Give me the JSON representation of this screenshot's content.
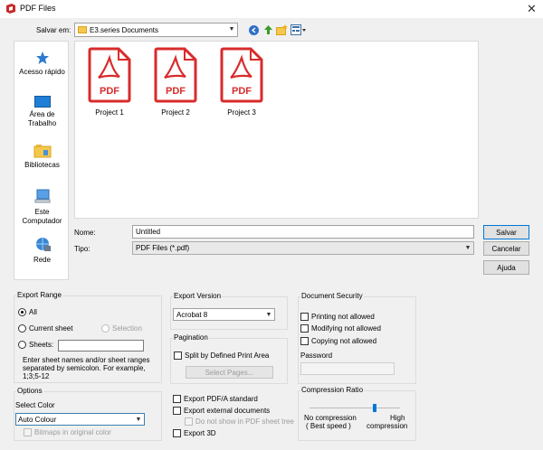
{
  "window": {
    "title": "PDF Files"
  },
  "toolbar": {
    "save_in_label": "Salvar em:",
    "save_in_value": "E3.series Documents"
  },
  "sidebar": {
    "items": [
      {
        "label": "Acesso rápido"
      },
      {
        "label": "Área de Trabalho"
      },
      {
        "label": "Bibliotecas"
      },
      {
        "label": "Este Computador"
      },
      {
        "label": "Rede"
      }
    ]
  },
  "files": [
    {
      "name": "Project 1",
      "badge": "PDF"
    },
    {
      "name": "Project 2",
      "badge": "PDF"
    },
    {
      "name": "Project 3",
      "badge": "PDF"
    }
  ],
  "form": {
    "name_label": "Nome:",
    "name_value": "Untitled",
    "type_label": "Tipo:",
    "type_value": "PDF Files (*.pdf)"
  },
  "buttons": {
    "save": "Salvar",
    "cancel": "Cancelar",
    "help": "Ajuda"
  },
  "export_range": {
    "title": "Export Range",
    "all": "All",
    "current_sheet": "Current sheet",
    "selection": "Selection",
    "sheets": "Sheets:",
    "hint": "Enter sheet names and/or sheet ranges separated by semicolon. For example, 1;3;5-12"
  },
  "options": {
    "title": "Options",
    "select_color": "Select Color",
    "color_value": "Auto Colour",
    "bitmaps": "Bitmaps in original color"
  },
  "export_version": {
    "title": "Export Version",
    "value": "Acrobat 8"
  },
  "pagination": {
    "title": "Pagination",
    "split": "Split by Defined Print Area",
    "select_pages": "Select Pages..."
  },
  "export_checks": {
    "pdfa": "Export PDF/A standard",
    "external": "Export external documents",
    "do_not_show": "Do not show in PDF sheet tree",
    "export3d": "Export 3D"
  },
  "security": {
    "title": "Document Security",
    "printing": "Printing not allowed",
    "modifying": "Modifying not allowed",
    "copying": "Copying not allowed",
    "password": "Password"
  },
  "compression": {
    "title": "Compression Ratio",
    "left_label_1": "No compression",
    "left_label_2": "( Best speed )",
    "right_label_1": "High",
    "right_label_2": "compression",
    "level": 0.72
  },
  "colors": {
    "accent": "#0078d7",
    "pdf_red": "#d92b2b"
  }
}
